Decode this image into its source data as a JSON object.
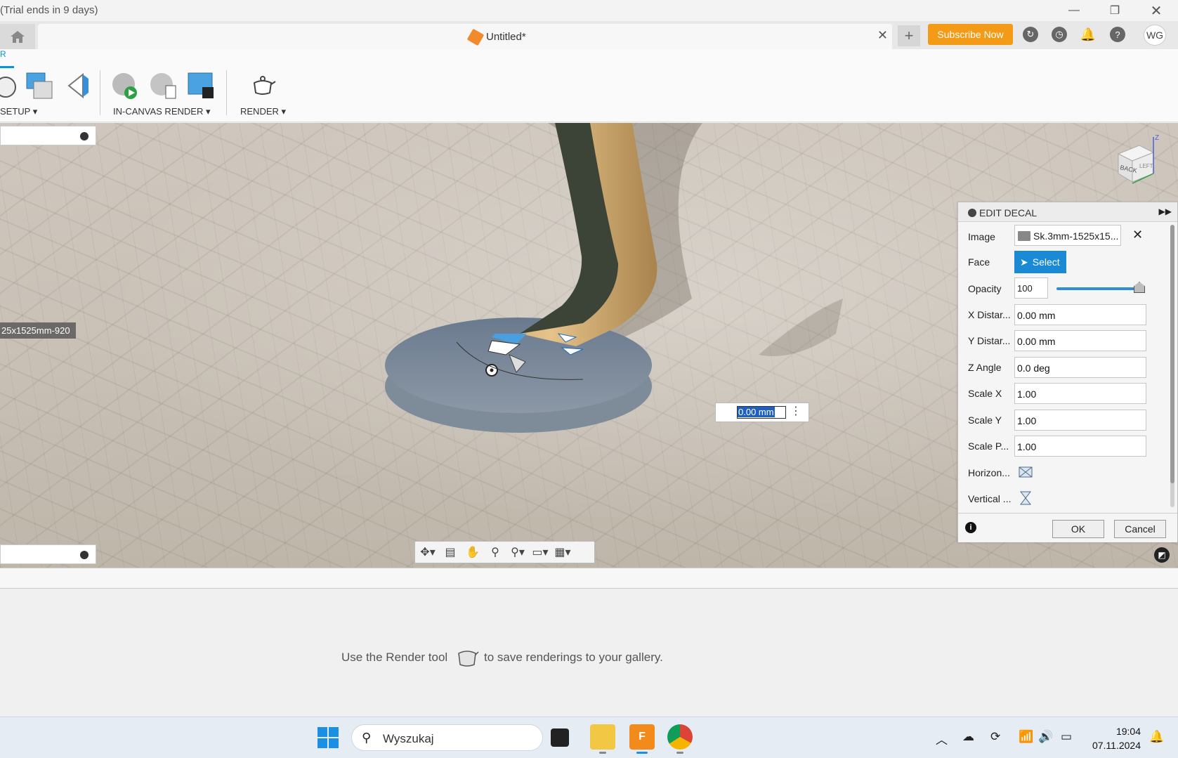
{
  "titlebar": {
    "trial_text": "(Trial ends in 9 days)"
  },
  "tabs": {
    "doc_title": "Untitled*",
    "subscribe_label": "Subscribe Now",
    "user_initials": "WG"
  },
  "toolbar": {
    "active_tab_fragment": "R",
    "groups": {
      "setup": "SETUP ▾",
      "in_canvas_render": "IN-CANVAS RENDER ▾",
      "render": "RENDER ▾"
    }
  },
  "viewport": {
    "decal_tag": "25x1525mm-920",
    "dimension_value": "0.00 mm",
    "viewcube": {
      "back": "BACK",
      "left": "LEFT",
      "z_axis": "Z"
    }
  },
  "edit_decal": {
    "title": "EDIT DECAL",
    "rows": {
      "image_label": "Image",
      "image_value": "Sk.3mm-1525x15...",
      "face_label": "Face",
      "face_button": "Select",
      "opacity_label": "Opacity",
      "opacity_value": "100",
      "opacity_level": 1.0,
      "x_label": "X Distar...",
      "x_value": "0.00 mm",
      "y_label": "Y Distar...",
      "y_value": "0.00 mm",
      "z_label": "Z Angle",
      "z_value": "0.0 deg",
      "sx_label": "Scale X",
      "sx_value": "1.00",
      "sy_label": "Scale Y",
      "sy_value": "1.00",
      "sp_label": "Scale P...",
      "sp_value": "1.00",
      "h_label": "Horizon...",
      "v_label": "Vertical ..."
    },
    "ok_label": "OK",
    "cancel_label": "Cancel"
  },
  "gallery": {
    "message_before": "Use the Render tool",
    "message_after": "to save renderings to your gallery."
  },
  "taskbar": {
    "search_placeholder": "Wyszukaj",
    "time": "19:04",
    "date": "07.11.2024"
  },
  "colors": {
    "accent": "#0696d7",
    "subscribe": "#f39a16",
    "select_button": "#1a8ad4"
  }
}
